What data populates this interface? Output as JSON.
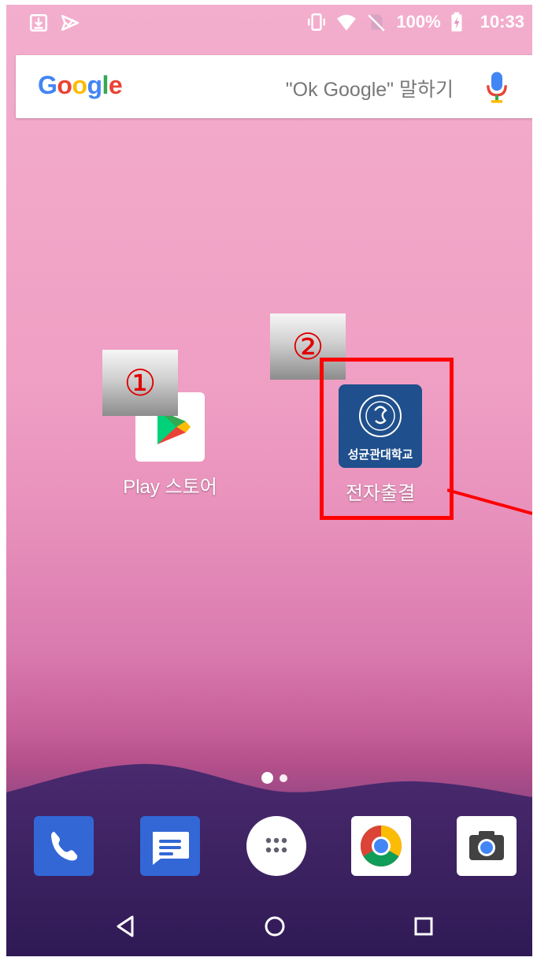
{
  "status_bar": {
    "left_icons": [
      "download-icon",
      "notification-check-icon"
    ],
    "right_icons": [
      "vibrate-icon",
      "wifi-icon",
      "no-sim-icon",
      "battery-charging-icon"
    ],
    "battery": "100%",
    "time": "10:33"
  },
  "search_bar": {
    "logo": "Google",
    "hint": "\"Ok Google\" 말하기",
    "mic_icon": "mic-icon",
    "logo_colors": [
      "#4285F4",
      "#EA4335",
      "#FBBC05",
      "#4285F4",
      "#34A853",
      "#EA4335"
    ]
  },
  "apps": [
    {
      "label": "Play 스토어",
      "icon": "play-store-icon"
    },
    {
      "label": "전자출결",
      "icon": "skku-icon",
      "icon_text": "성균관대학교"
    }
  ],
  "markers": [
    "①",
    "②"
  ],
  "highlight_color": "#ff0000",
  "page_indicator": {
    "pages": 2,
    "current": 1
  },
  "dock": [
    {
      "name": "phone",
      "icon": "phone-icon",
      "color": "#3367d6"
    },
    {
      "name": "messages",
      "icon": "messages-icon",
      "color": "#3367d6"
    },
    {
      "name": "app-drawer",
      "icon": "app-drawer-icon",
      "color": "#ffffff"
    },
    {
      "name": "chrome",
      "icon": "chrome-icon",
      "color": "#ffffff"
    },
    {
      "name": "camera",
      "icon": "camera-icon",
      "color": "#ffffff"
    }
  ],
  "nav": [
    "back-icon",
    "home-icon",
    "recents-icon"
  ]
}
